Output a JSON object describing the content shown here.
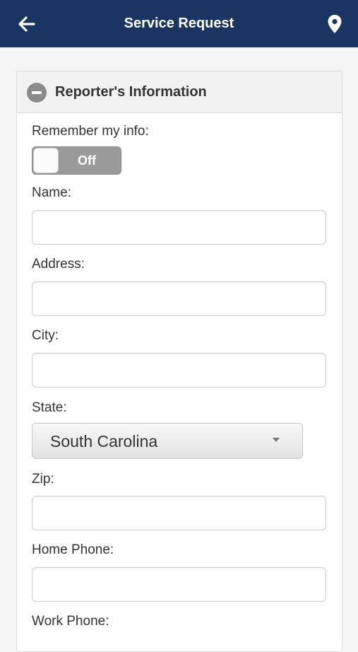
{
  "header": {
    "title": "Service Request",
    "back_icon": "arrow-left-icon",
    "location_icon": "map-pin-icon"
  },
  "section": {
    "title": "Reporter's Information",
    "collapse_icon": "minus-circle-icon",
    "remember_label": "Remember my info:",
    "remember_state": "Off",
    "fields": {
      "name_label": "Name:",
      "address_label": "Address:",
      "city_label": "City:",
      "state_label": "State:",
      "state_value": "South Carolina",
      "zip_label": "Zip:",
      "home_phone_label": "Home Phone:",
      "work_phone_label": "Work Phone:"
    }
  },
  "colors": {
    "header_bg": "#1b3563",
    "toggle_off": "#9a9a9a"
  }
}
